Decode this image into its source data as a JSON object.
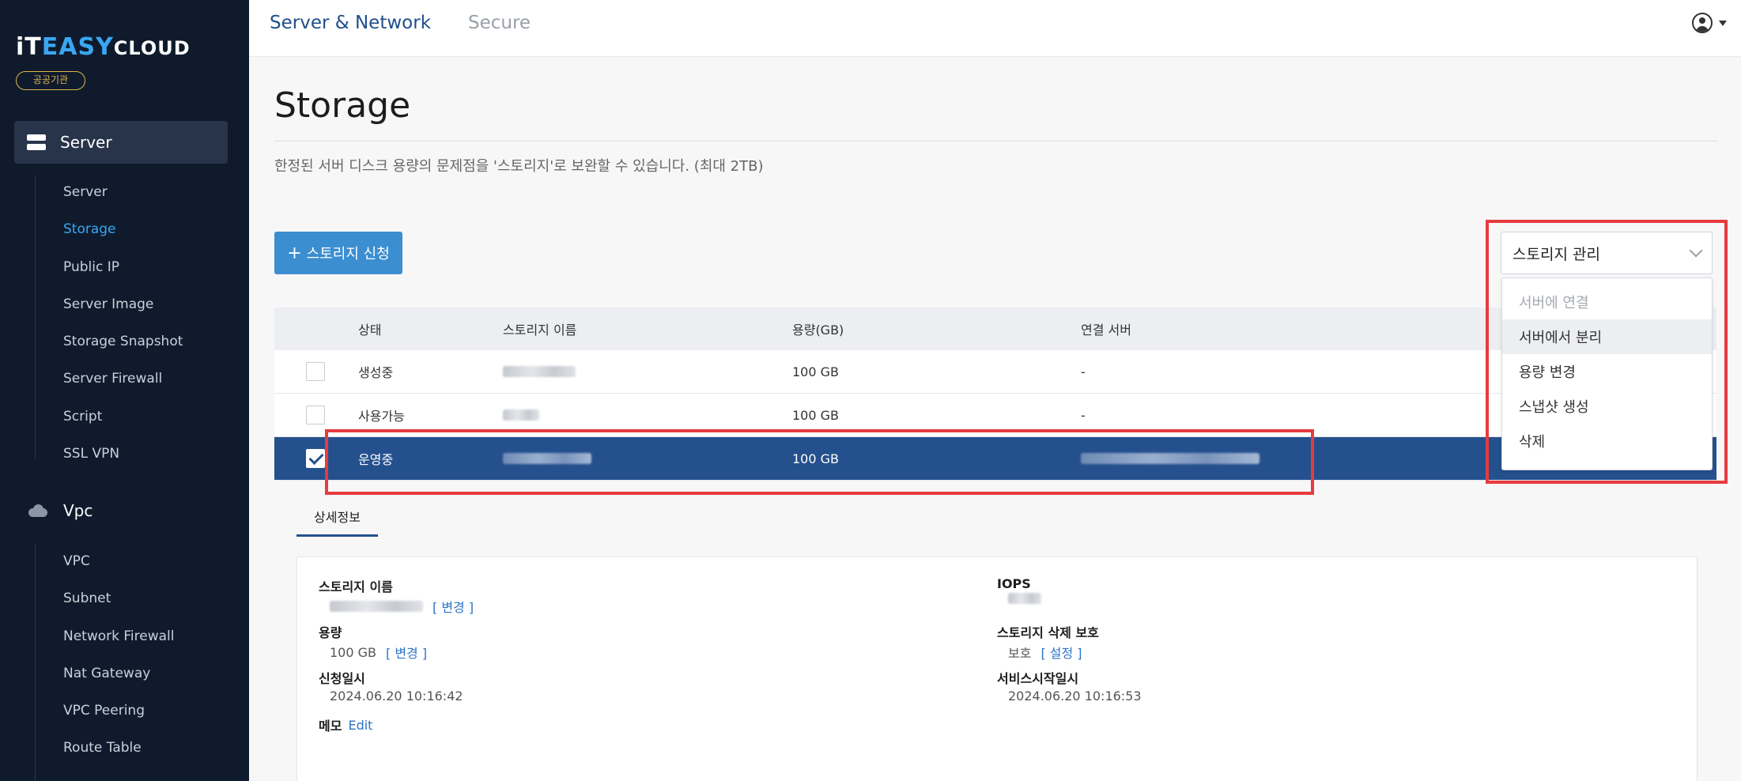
{
  "brand": {
    "logo_part1": "iT",
    "logo_part2": "EASY",
    "logo_part3": "CLOUD",
    "badge": "공공기관"
  },
  "sidebar": {
    "groups": [
      {
        "label": "Server",
        "items": [
          "Server",
          "Storage",
          "Public IP",
          "Server Image",
          "Storage Snapshot",
          "Server Firewall",
          "Script",
          "SSL VPN"
        ]
      },
      {
        "label": "Vpc",
        "items": [
          "VPC",
          "Subnet",
          "Network Firewall",
          "Nat Gateway",
          "VPC Peering",
          "Route Table"
        ]
      }
    ],
    "current_item": "Storage"
  },
  "topnav": {
    "tabs": [
      "Server & Network",
      "Secure"
    ],
    "active_tab": "Server & Network"
  },
  "page": {
    "title": "Storage",
    "description": "한정된 서버 디스크 용량의 문제점을 '스토리지'로 보완할 수 있습니다. (최대 2TB)",
    "add_button": "스토리지 신청",
    "add_button_icon": "plus-icon"
  },
  "table": {
    "headers": [
      "상태",
      "스토리지 이름",
      "용량(GB)",
      "연결 서버"
    ],
    "rows": [
      {
        "status": "생성중",
        "capacity": "100 GB",
        "server": "-",
        "checked": false,
        "selected": false
      },
      {
        "status": "사용가능",
        "capacity": "100 GB",
        "server": "-",
        "checked": false,
        "selected": false
      },
      {
        "status": "운영중",
        "capacity": "100 GB",
        "server": "",
        "checked": true,
        "selected": true
      }
    ]
  },
  "manage_dropdown": {
    "selected": "스토리지 관리",
    "options": [
      "서버에 연결",
      "서버에서 분리",
      "용량 변경",
      "스냅샷 생성",
      "삭제"
    ],
    "disabled_option": "서버에 연결",
    "hovered_option": "서버에서 분리"
  },
  "details": {
    "tab": "상세정보",
    "storage_name_label": "스토리지 이름",
    "change_link": "[ 변경 ]",
    "capacity_label": "용량",
    "capacity_value": "100 GB",
    "requested_label": "신청일시",
    "requested_value": "2024.06.20 10:16:42",
    "memo_label": "메모",
    "memo_link": "Edit",
    "iops_label": "IOPS",
    "delete_protect_label": "스토리지 삭제 보호",
    "delete_protect_value": "보호",
    "settings_link": "[ 설정 ]",
    "service_start_label": "서비스시작일시",
    "service_start_value": "2024.06.20 10:16:53"
  },
  "colors": {
    "sidebar_bg": "#0f1b2d",
    "accent": "#3aa6f2",
    "primary_button": "#3b8ed0",
    "selected_row": "#25508e",
    "highlight": "#e63b3f"
  }
}
